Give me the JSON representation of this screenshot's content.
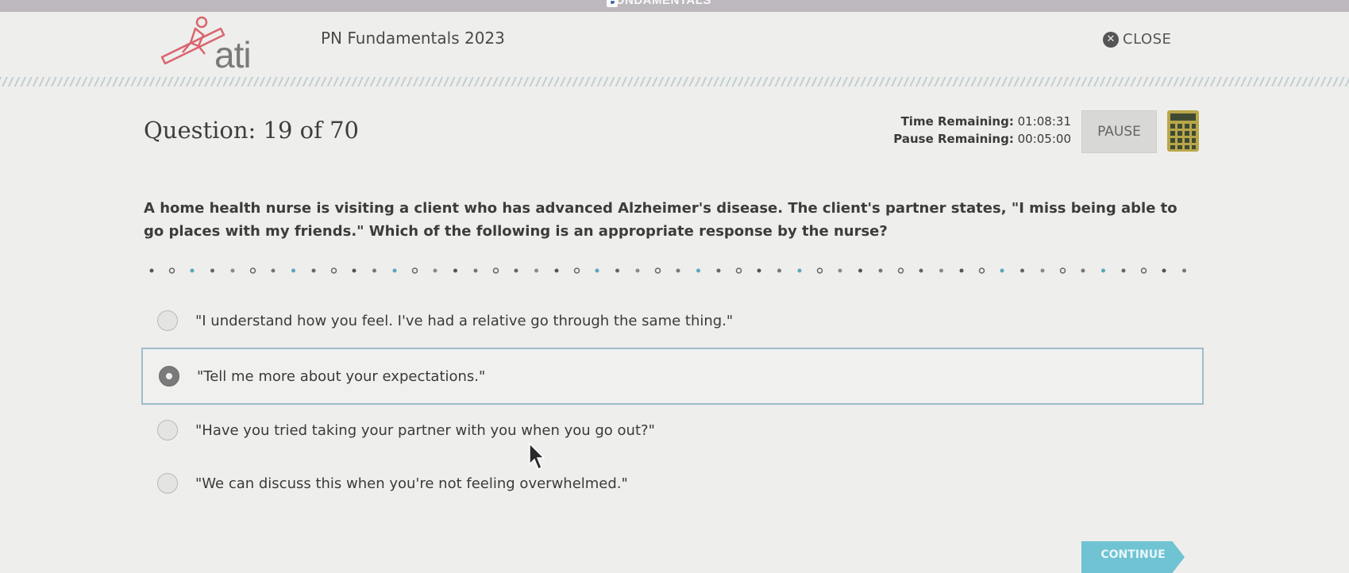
{
  "topbar": {
    "label": "FUNDAMENTALS"
  },
  "header": {
    "logo_text": "ati",
    "app_title": "PN Fundamentals 2023",
    "close_label": "CLOSE"
  },
  "question": {
    "number_label": "Question: 19 of 70",
    "stem": "A home health nurse is visiting a client who has advanced Alzheimer's disease. The client's partner states, \"I miss being able to go places with my friends.\" Which of the following is an appropriate response by the nurse?"
  },
  "timers": {
    "time_label": "Time Remaining:",
    "time_value": "01:08:31",
    "pause_label": "Pause Remaining:",
    "pause_value": "00:05:00"
  },
  "controls": {
    "pause_label": "PAUSE",
    "continue_label": "CONTINUE"
  },
  "options": [
    {
      "text": "\"I understand how you feel. I've had a relative go through the same thing.\"",
      "selected": false
    },
    {
      "text": "\"Tell me more about your expectations.\"",
      "selected": true
    },
    {
      "text": "\"Have you tried taking your partner with you when you go out?\"",
      "selected": false
    },
    {
      "text": "\"We can discuss this when you're not feeling overwhelmed.\"",
      "selected": false
    }
  ],
  "colors": {
    "accent": "#6fc3d2",
    "selected_border": "#9fbccb",
    "logo_red": "#d9646e",
    "calculator_yellow": "#b8a74a",
    "calculator_dark": "#3f4a33"
  },
  "icons": [
    "ati-logo-icon",
    "close-icon",
    "calculator-icon",
    "radio-icon",
    "cursor-icon",
    "continue-arrow-icon"
  ]
}
